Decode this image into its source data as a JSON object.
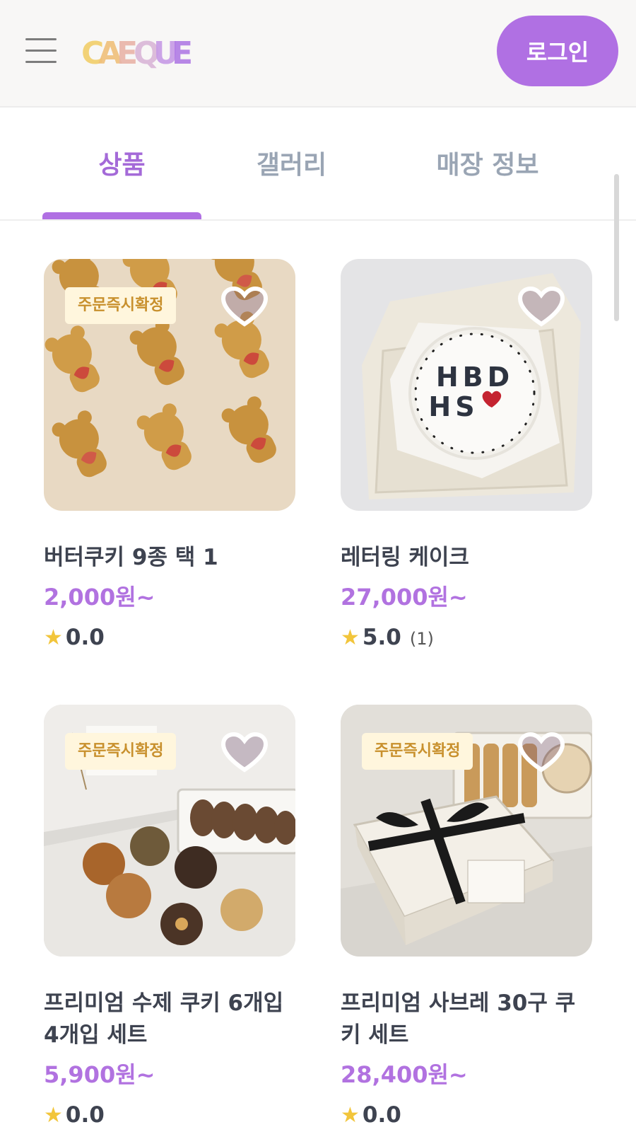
{
  "header": {
    "logo_text": "CAEQUE",
    "login_label": "로그인"
  },
  "tabs": [
    {
      "label": "상품",
      "active": true
    },
    {
      "label": "갤러리",
      "active": false
    },
    {
      "label": "매장 정보",
      "active": false
    }
  ],
  "colors": {
    "accent": "#b070e3",
    "price": "#b172e0",
    "badge_bg": "#fff6dd",
    "badge_text": "#c8902d",
    "star": "#f2c53b",
    "tab_inactive": "#9aa5b4"
  },
  "products": [
    {
      "title": "버터쿠키 9종 택 1",
      "price": "2,000원~",
      "rating": "0.0",
      "review_count": "",
      "badge": "주문즉시확정",
      "image": "bear-cookies"
    },
    {
      "title": "레터링 케이크",
      "price": "27,000원~",
      "rating": "5.0",
      "review_count": "(1)",
      "badge": "",
      "image": "lettering-cake"
    },
    {
      "title": "프리미엄 수제 쿠키 6개입 4개입 세트",
      "price": "5,900원~",
      "rating": "0.0",
      "review_count": "",
      "badge": "주문즉시확정",
      "image": "handmade-cookie-box"
    },
    {
      "title": "프리미엄 사브레 30구 쿠키 세트",
      "price": "28,400원~",
      "rating": "0.0",
      "review_count": "",
      "badge": "주문즉시확정",
      "image": "sable-gift-box"
    }
  ],
  "cake_lettering": {
    "line1": "HBD",
    "line2": "HS"
  }
}
